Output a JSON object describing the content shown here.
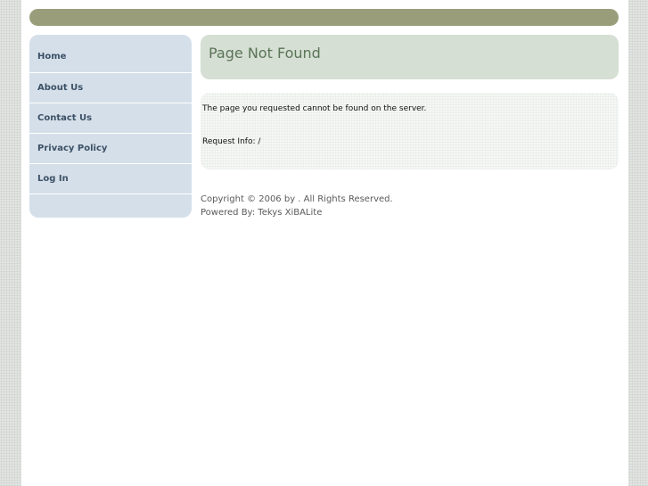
{
  "header": {
    "bar_color": "#9a9d7a"
  },
  "sidebar": {
    "items": [
      {
        "label": "Home"
      },
      {
        "label": "About Us"
      },
      {
        "label": "Contact Us"
      },
      {
        "label": "Privacy Policy"
      },
      {
        "label": "Log In"
      }
    ]
  },
  "main": {
    "title": "Page Not Found",
    "message": "The page you requested cannot be found on the server.",
    "request_info": "Request Info: /"
  },
  "footer": {
    "copyright": "Copyright © 2006 by . All Rights Reserved.",
    "powered_by": "Powered By: Tekys XiBALite"
  },
  "colors": {
    "sidebar_bg": "#d5dfe9",
    "title_bg": "#d5dfd3",
    "title_text": "#5b7458",
    "nav_text": "#3c5166"
  }
}
